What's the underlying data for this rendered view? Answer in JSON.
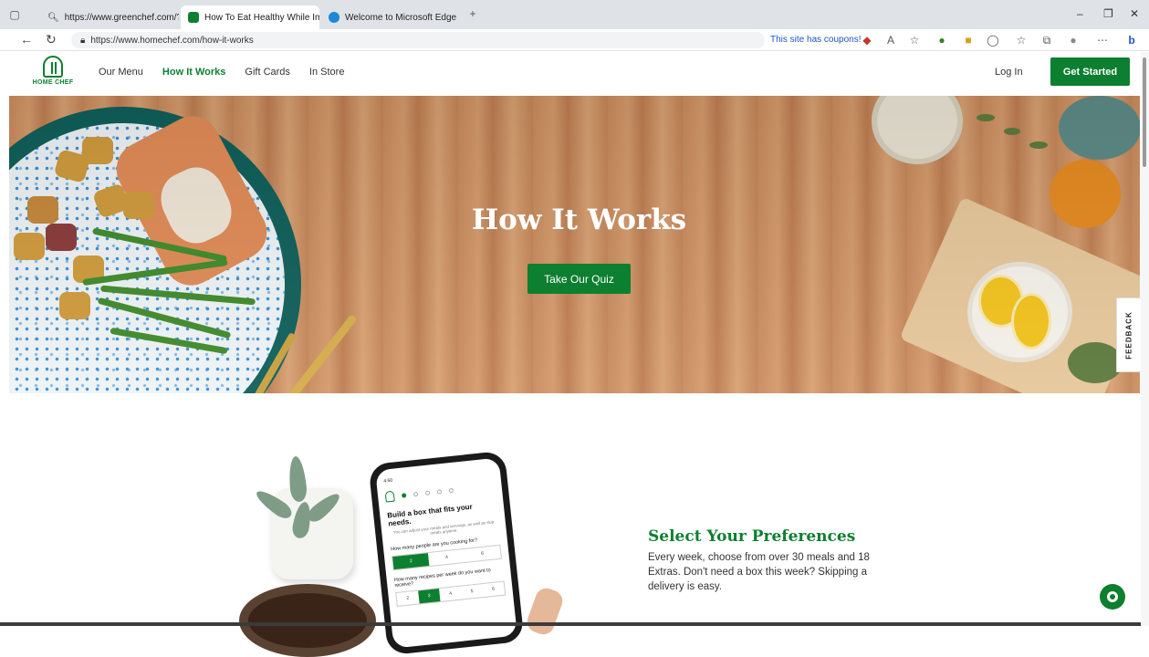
{
  "browser": {
    "tabs": [
      {
        "label": "https://www.greenchef.com/?ut",
        "active": false
      },
      {
        "label": "How To Eat Healthy While Impro",
        "active": true
      },
      {
        "label": "Welcome to Microsoft Edge",
        "active": false
      }
    ],
    "url": "https://www.homechef.com/how-it-works",
    "coupons_text": "This site has coupons!"
  },
  "header": {
    "logo_text": "HOME CHEF",
    "nav": [
      "Our Menu",
      "How It Works",
      "Gift Cards",
      "In Store"
    ],
    "active_nav": "How It Works",
    "login": "Log In",
    "cta": "Get Started"
  },
  "hero": {
    "title": "How It Works",
    "button": "Take Our Quiz",
    "feedback": "FEEDBACK"
  },
  "phone": {
    "time": "4:50",
    "headline": "Build a box that fits your needs.",
    "subtext": "You can adjust your meals and servings, as well as skip meals anytime.",
    "question1": "How many people are you cooking for?",
    "options1": [
      "2",
      "4",
      "6"
    ],
    "question2": "How many recipes per week do you want to receive?",
    "options2": [
      "2",
      "3",
      "4",
      "5",
      "6"
    ]
  },
  "preferences": {
    "title": "Select Your Preferences",
    "body": "Every week, choose from over 30 meals and 18 Extras. Don't need a box this week? Skipping a delivery is easy."
  },
  "colors": {
    "brand_green": "#0d7f30",
    "wood": "#c98a5c"
  }
}
